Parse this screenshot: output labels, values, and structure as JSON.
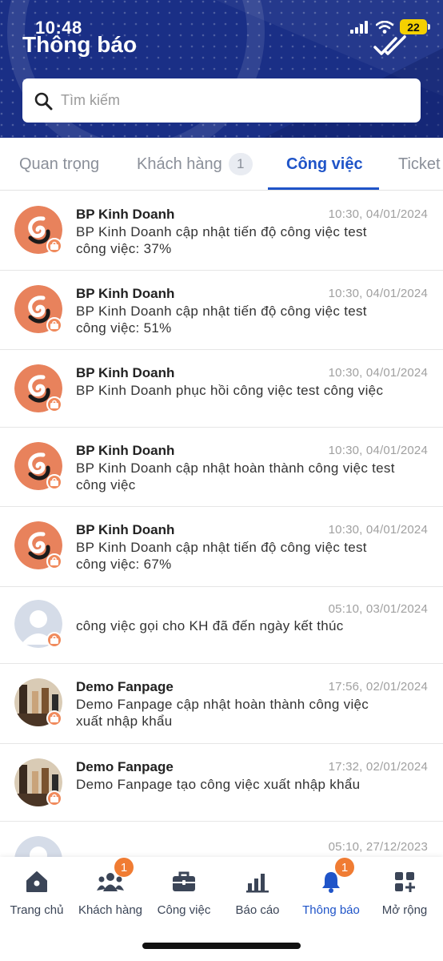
{
  "status_bar": {
    "time": "10:48",
    "battery": "22"
  },
  "header": {
    "title": "Thông báo"
  },
  "search": {
    "placeholder": "Tìm kiếm"
  },
  "tabs": [
    {
      "label": "Quan trọng",
      "active": false
    },
    {
      "label": "Khách hàng",
      "badge": "1",
      "active": false
    },
    {
      "label": "Công việc",
      "active": true
    },
    {
      "label": "Ticket",
      "active": false
    }
  ],
  "notifications": [
    {
      "sender": "BP Kinh Doanh",
      "time": "10:30, 04/01/2024",
      "line1": "BP Kinh Doanh cập nhật tiến độ công việc test",
      "line2": "công việc: 37%",
      "avatar": "brand-logo"
    },
    {
      "sender": "BP Kinh Doanh",
      "time": "10:30, 04/01/2024",
      "line1": "BP Kinh Doanh cập nhật tiến độ công việc test",
      "line2": "công việc: 51%",
      "avatar": "brand-logo"
    },
    {
      "sender": "BP Kinh Doanh",
      "time": "10:30, 04/01/2024",
      "line1": "BP Kinh Doanh phục hồi công việc test công việc",
      "line2": "",
      "avatar": "brand-logo"
    },
    {
      "sender": "BP Kinh Doanh",
      "time": "10:30, 04/01/2024",
      "line1": "BP Kinh Doanh cập nhật hoàn thành công việc test",
      "line2": "công việc",
      "avatar": "brand-logo"
    },
    {
      "sender": "BP Kinh Doanh",
      "time": "10:30, 04/01/2024",
      "line1": "BP Kinh Doanh cập nhật tiến độ công việc test",
      "line2": "công việc: 67%",
      "avatar": "brand-logo"
    },
    {
      "sender": "",
      "time": "05:10, 03/01/2024",
      "line1": "công việc gọi cho KH đã đến ngày kết thúc",
      "line2": "",
      "avatar": "default-user"
    },
    {
      "sender": "Demo Fanpage",
      "time": "17:56, 02/01/2024",
      "line1": "Demo Fanpage cập nhật hoàn thành công việc",
      "line2": "xuất nhập khẩu",
      "avatar": "photo"
    },
    {
      "sender": "Demo Fanpage",
      "time": "17:32, 02/01/2024",
      "line1": "Demo Fanpage tạo công việc xuất nhập khẩu",
      "line2": "",
      "avatar": "photo"
    },
    {
      "sender": "",
      "time": "05:10, 27/12/2023",
      "line1": "",
      "line2": "",
      "avatar": "default-user"
    }
  ],
  "bottom_nav": [
    {
      "label": "Trang chủ",
      "icon": "home-icon"
    },
    {
      "label": "Khách hàng",
      "icon": "users-icon",
      "badge": "1"
    },
    {
      "label": "Công việc",
      "icon": "briefcase-icon"
    },
    {
      "label": "Báo cáo",
      "icon": "bar-chart-icon"
    },
    {
      "label": "Thông báo",
      "icon": "bell-icon",
      "badge": "1",
      "active": true
    },
    {
      "label": "Mở rộng",
      "icon": "grid-plus-icon"
    }
  ],
  "colors": {
    "header_bg": "#1a2f86",
    "accent": "#1f54c8",
    "badge": "#f07c33",
    "avatar_orange": "#e8825c"
  }
}
